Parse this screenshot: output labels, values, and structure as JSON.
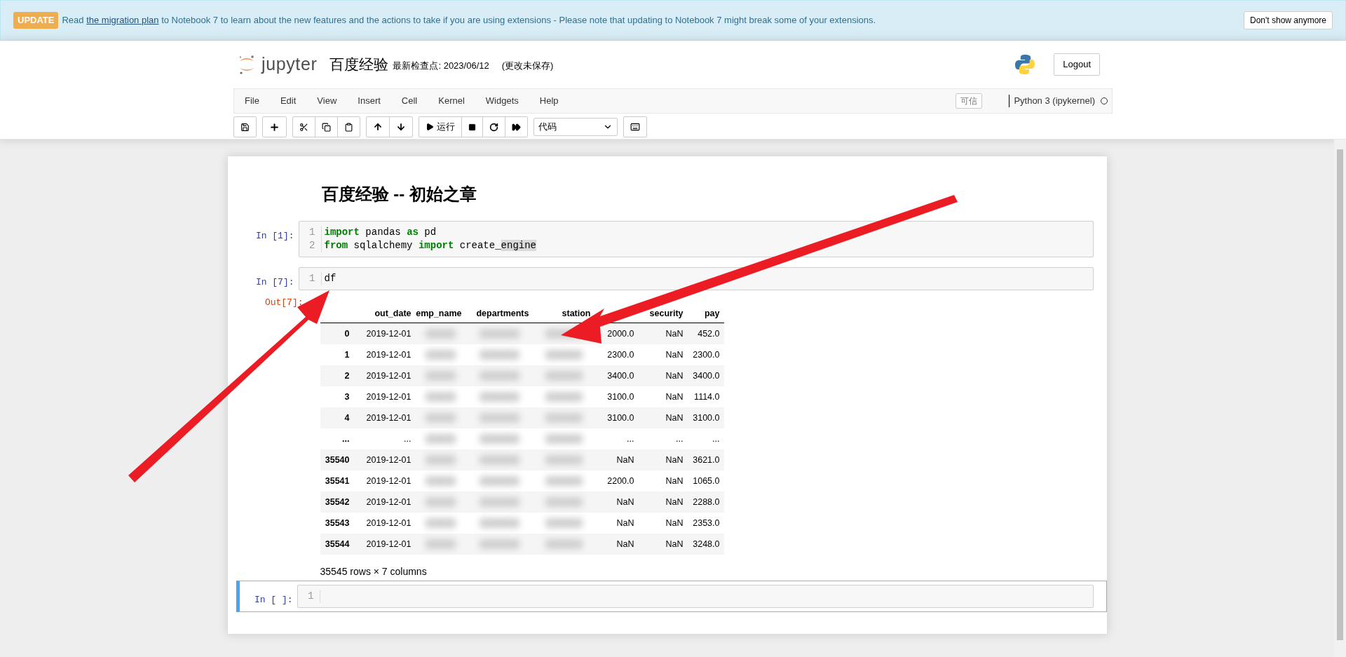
{
  "banner": {
    "badge": "UPDATE",
    "before": "Read",
    "link": "the migration plan",
    "after": "to Notebook 7 to learn about the new features and the actions to take if you are using extensions - Please note that updating to Notebook 7 might break some of your extensions.",
    "dismiss": "Don't show anymore"
  },
  "header": {
    "logo_text": "jupyter",
    "notebook_name": "百度经验",
    "checkpoint": "最新检查点: 2023/06/12",
    "unsaved": "(更改未保存)",
    "logout": "Logout"
  },
  "menu": [
    "File",
    "Edit",
    "View",
    "Insert",
    "Cell",
    "Kernel",
    "Widgets",
    "Help"
  ],
  "trusted": "可信",
  "kernel": "Python 3 (ipykernel)",
  "toolbar": {
    "run_label": "运行",
    "cell_type": "代码"
  },
  "heading": "百度经验 -- 初始之章",
  "cells": [
    {
      "prompt": "In [1]:",
      "selected": false,
      "lines": [
        {
          "number": "1",
          "tokens": [
            {
              "kind": "keyword",
              "text": "import"
            },
            {
              "kind": "plain",
              "text": " pandas "
            },
            {
              "kind": "keyword",
              "text": "as"
            },
            {
              "kind": "plain",
              "text": " pd"
            }
          ]
        },
        {
          "number": "2",
          "tokens": [
            {
              "kind": "keyword",
              "text": "from"
            },
            {
              "kind": "plain",
              "text": " sqlalchemy "
            },
            {
              "kind": "keyword",
              "text": "import"
            },
            {
              "kind": "plain",
              "text": " create_"
            },
            {
              "kind": "match",
              "text": "engine"
            }
          ]
        }
      ]
    },
    {
      "prompt": "In [7]:",
      "selected": false,
      "lines": [
        {
          "number": "1",
          "tokens": [
            {
              "kind": "plain",
              "text": "df"
            }
          ]
        }
      ],
      "output": {
        "prompt": "Out[7]:",
        "columns": [
          "out_date",
          "emp_name",
          "departments",
          "station",
          "",
          "security",
          "pay"
        ],
        "rows": [
          {
            "index": "0",
            "cells": [
              {
                "text": "2019-12-01",
                "blurred": false
              },
              {
                "blurred": true
              },
              {
                "blurred": true
              },
              {
                "blurred": true
              },
              {
                "text": "2000.0",
                "blurred": false
              },
              {
                "text": "NaN",
                "blurred": false
              },
              {
                "text": "452.0",
                "blurred": false
              }
            ]
          },
          {
            "index": "1",
            "cells": [
              {
                "text": "2019-12-01",
                "blurred": false
              },
              {
                "blurred": true
              },
              {
                "blurred": true
              },
              {
                "blurred": true
              },
              {
                "text": "2300.0",
                "blurred": false
              },
              {
                "text": "NaN",
                "blurred": false
              },
              {
                "text": "2300.0",
                "blurred": false
              }
            ]
          },
          {
            "index": "2",
            "cells": [
              {
                "text": "2019-12-01",
                "blurred": false
              },
              {
                "blurred": true
              },
              {
                "blurred": true
              },
              {
                "blurred": true
              },
              {
                "text": "3400.0",
                "blurred": false
              },
              {
                "text": "NaN",
                "blurred": false
              },
              {
                "text": "3400.0",
                "blurred": false
              }
            ]
          },
          {
            "index": "3",
            "cells": [
              {
                "text": "2019-12-01",
                "blurred": false
              },
              {
                "blurred": true
              },
              {
                "blurred": true
              },
              {
                "blurred": true
              },
              {
                "text": "3100.0",
                "blurred": false
              },
              {
                "text": "NaN",
                "blurred": false
              },
              {
                "text": "1114.0",
                "blurred": false
              }
            ]
          },
          {
            "index": "4",
            "cells": [
              {
                "text": "2019-12-01",
                "blurred": false
              },
              {
                "blurred": true
              },
              {
                "blurred": true
              },
              {
                "blurred": true
              },
              {
                "text": "3100.0",
                "blurred": false
              },
              {
                "text": "NaN",
                "blurred": false
              },
              {
                "text": "3100.0",
                "blurred": false
              }
            ]
          },
          {
            "index": "...",
            "cells": [
              {
                "text": "...",
                "blurred": false
              },
              {
                "blurred": true
              },
              {
                "blurred": true
              },
              {
                "blurred": true
              },
              {
                "text": "...",
                "blurred": false
              },
              {
                "text": "...",
                "blurred": false
              },
              {
                "text": "...",
                "blurred": false
              }
            ]
          },
          {
            "index": "35540",
            "cells": [
              {
                "text": "2019-12-01",
                "blurred": false
              },
              {
                "blurred": true
              },
              {
                "blurred": true
              },
              {
                "blurred": true
              },
              {
                "text": "NaN",
                "blurred": false
              },
              {
                "text": "NaN",
                "blurred": false
              },
              {
                "text": "3621.0",
                "blurred": false
              }
            ]
          },
          {
            "index": "35541",
            "cells": [
              {
                "text": "2019-12-01",
                "blurred": false
              },
              {
                "blurred": true
              },
              {
                "blurred": true
              },
              {
                "blurred": true
              },
              {
                "text": "2200.0",
                "blurred": false
              },
              {
                "text": "NaN",
                "blurred": false
              },
              {
                "text": "1065.0",
                "blurred": false
              }
            ]
          },
          {
            "index": "35542",
            "cells": [
              {
                "text": "2019-12-01",
                "blurred": false
              },
              {
                "blurred": true
              },
              {
                "blurred": true
              },
              {
                "blurred": true
              },
              {
                "text": "NaN",
                "blurred": false
              },
              {
                "text": "NaN",
                "blurred": false
              },
              {
                "text": "2288.0",
                "blurred": false
              }
            ]
          },
          {
            "index": "35543",
            "cells": [
              {
                "text": "2019-12-01",
                "blurred": false
              },
              {
                "blurred": true
              },
              {
                "blurred": true
              },
              {
                "blurred": true
              },
              {
                "text": "NaN",
                "blurred": false
              },
              {
                "text": "NaN",
                "blurred": false
              },
              {
                "text": "2353.0",
                "blurred": false
              }
            ]
          },
          {
            "index": "35544",
            "cells": [
              {
                "text": "2019-12-01",
                "blurred": false
              },
              {
                "blurred": true
              },
              {
                "blurred": true
              },
              {
                "blurred": true
              },
              {
                "text": "NaN",
                "blurred": false
              },
              {
                "text": "NaN",
                "blurred": false
              },
              {
                "text": "3248.0",
                "blurred": false
              }
            ]
          }
        ],
        "summary": "35545 rows × 7 columns"
      }
    },
    {
      "prompt": "In [ ]:",
      "selected": true,
      "lines": [
        {
          "number": "1"
        }
      ]
    }
  ]
}
